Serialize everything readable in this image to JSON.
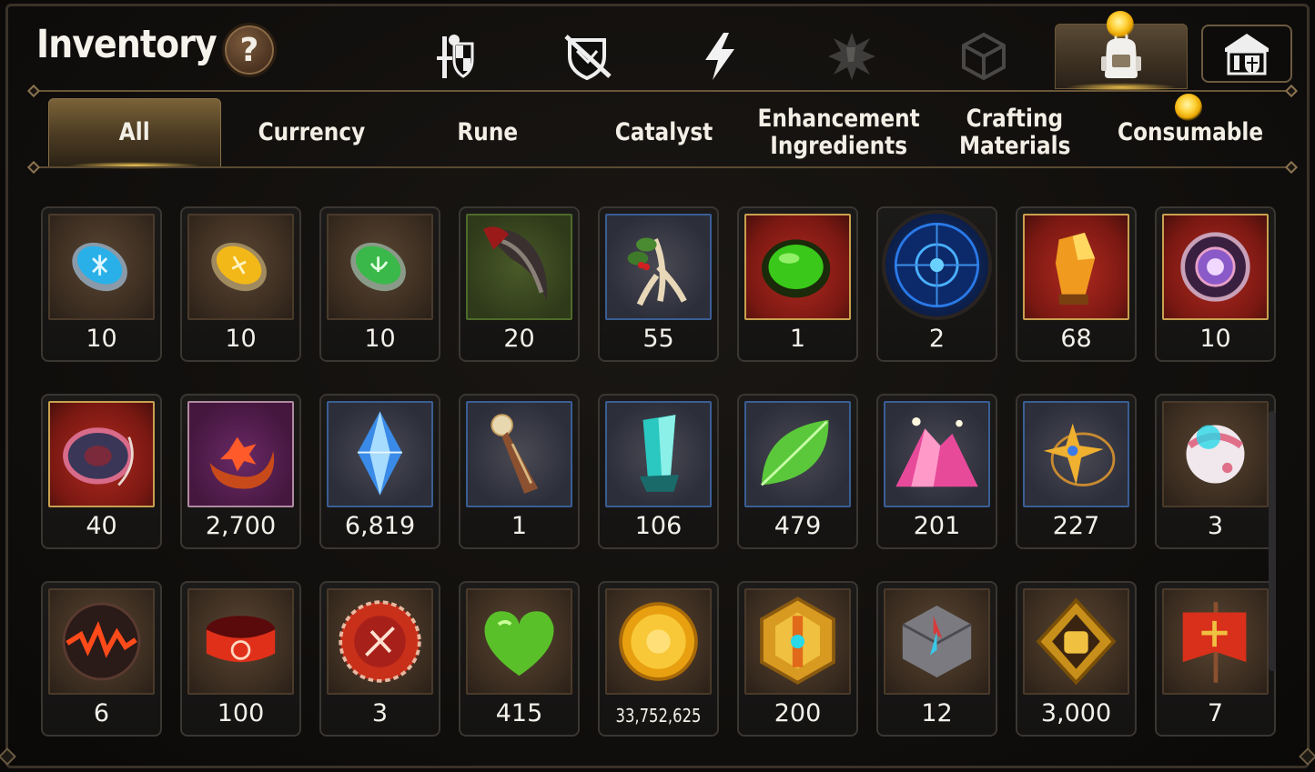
{
  "header": {
    "title": "Inventory",
    "help_label": "?",
    "tabs": [
      {
        "icon": "sword-shield-icon",
        "active": false
      },
      {
        "icon": "broken-shield-icon",
        "active": false
      },
      {
        "icon": "lightning-icon",
        "active": false
      },
      {
        "icon": "burst-icon",
        "active": false
      },
      {
        "icon": "cube-icon",
        "active": false
      },
      {
        "icon": "backpack-icon",
        "active": true,
        "notification": true
      },
      {
        "icon": "guild-hall-icon",
        "active": false
      }
    ]
  },
  "subtabs": {
    "items": [
      {
        "label": "All",
        "active": true
      },
      {
        "label": "Currency",
        "active": false
      },
      {
        "label": "Rune",
        "active": false
      },
      {
        "label": "Catalyst",
        "active": false
      },
      {
        "label": "Enhancement Ingredients",
        "line1": "Enhancement",
        "line2": "Ingredients",
        "active": false
      },
      {
        "label": "Crafting Materials",
        "line1": "Crafting",
        "line2": "Materials",
        "active": false
      },
      {
        "label": "Consumable",
        "active": false,
        "notification": true
      }
    ]
  },
  "items": [
    {
      "name": "blue-rune-stone-icon",
      "count": "10",
      "frame": "brown"
    },
    {
      "name": "yellow-rune-stone-icon",
      "count": "10",
      "frame": "brown"
    },
    {
      "name": "green-rune-stone-icon",
      "count": "10",
      "frame": "brown"
    },
    {
      "name": "beast-claw-icon",
      "count": "20",
      "frame": "green"
    },
    {
      "name": "ginseng-root-icon",
      "count": "55",
      "frame": "blue"
    },
    {
      "name": "green-gem-orb-icon",
      "count": "1",
      "frame": "red"
    },
    {
      "name": "blue-rune-circle-icon",
      "count": "2",
      "frame": "round"
    },
    {
      "name": "orange-crystal-icon",
      "count": "68",
      "frame": "red"
    },
    {
      "name": "purple-amulet-icon",
      "count": "10",
      "frame": "red"
    },
    {
      "name": "red-rope-ring-icon",
      "count": "40",
      "frame": "red"
    },
    {
      "name": "flower-crescent-ring-icon",
      "count": "2,700",
      "frame": "purple"
    },
    {
      "name": "blue-crystal-icon",
      "count": "6,819",
      "frame": "blue"
    },
    {
      "name": "compass-pendant-icon",
      "count": "1",
      "frame": "blue"
    },
    {
      "name": "teal-crystal-icon",
      "count": "106",
      "frame": "blue"
    },
    {
      "name": "green-leaf-icon",
      "count": "479",
      "frame": "blue"
    },
    {
      "name": "pink-crystal-pile-icon",
      "count": "201",
      "frame": "blue"
    },
    {
      "name": "star-necklace-icon",
      "count": "227",
      "frame": "blue"
    },
    {
      "name": "round-robot-icon",
      "count": "3",
      "frame": "brown"
    },
    {
      "name": "lava-orb-icon",
      "count": "6",
      "frame": "brown"
    },
    {
      "name": "red-bracelet-icon",
      "count": "100",
      "frame": "brown"
    },
    {
      "name": "red-seal-badge-icon",
      "count": "3",
      "frame": "brown"
    },
    {
      "name": "green-heart-icon",
      "count": "415",
      "frame": "brown"
    },
    {
      "name": "gold-coin-icon",
      "count": "33,752,625",
      "frame": "brown",
      "small": true
    },
    {
      "name": "hexagon-emblem-icon",
      "count": "200",
      "frame": "brown"
    },
    {
      "name": "stone-compass-icon",
      "count": "12",
      "frame": "brown"
    },
    {
      "name": "fist-emblem-icon",
      "count": "3,000",
      "frame": "brown"
    },
    {
      "name": "red-banner-icon",
      "count": "7",
      "frame": "brown"
    }
  ],
  "colors": {
    "accent_gold": "#ffd23a",
    "frame_border": "#6b5a40",
    "text": "#f4f1ea"
  }
}
